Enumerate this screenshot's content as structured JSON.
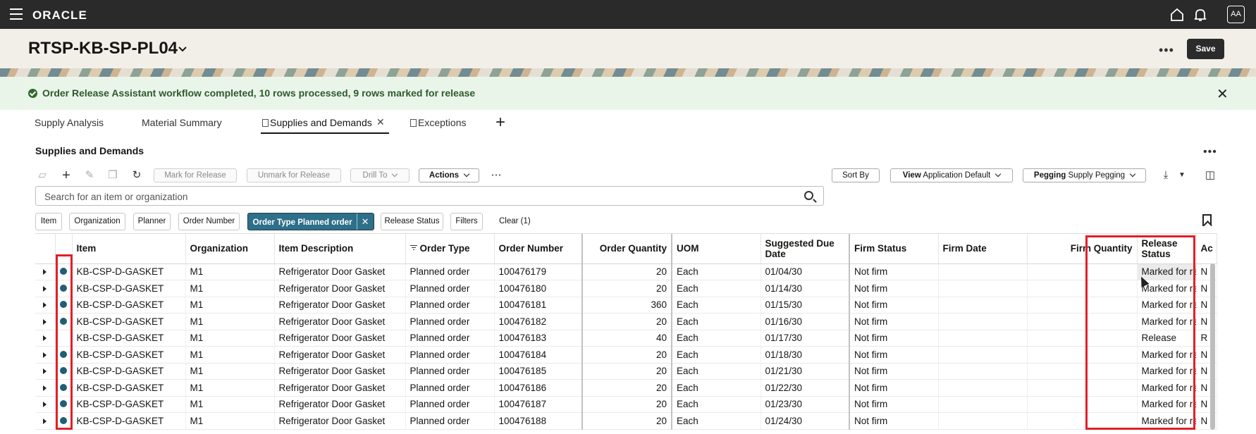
{
  "topbar": {
    "logo": "ORACLE",
    "avatar_initials": "AA"
  },
  "header": {
    "title": "RTSP-KB-SP-PL04",
    "save_label": "Save"
  },
  "banner": {
    "message": "Order Release Assistant workflow completed, 10 rows processed, 9 rows marked for release"
  },
  "tabs": [
    {
      "label": "Supply Analysis"
    },
    {
      "label": "Material Summary"
    },
    {
      "label": "Supplies and Demands"
    },
    {
      "label": "Exceptions"
    }
  ],
  "section": {
    "title": "Supplies and Demands"
  },
  "toolbar": {
    "mark_for_release": "Mark for Release",
    "unmark_for_release": "Unmark for Release",
    "drill_to": "Drill To",
    "actions": "Actions",
    "sort_by": "Sort By",
    "view_label": "View",
    "view_value": "Application Default",
    "pegging_label": "Pegging",
    "pegging_value": "Supply Pegging"
  },
  "search": {
    "placeholder": "Search for an item or organization"
  },
  "filters": {
    "chips": [
      "Item",
      "Organization",
      "Planner",
      "Order Number"
    ],
    "active_chip_label": "Order Type",
    "active_chip_value": "Planned order",
    "release_status": "Release Status",
    "filters_label": "Filters",
    "clear_label": "Clear (1)"
  },
  "table": {
    "columns": {
      "item": "Item",
      "organization": "Organization",
      "item_description": "Item Description",
      "order_type": "Order Type",
      "order_number": "Order Number",
      "order_quantity": "Order Quantity",
      "uom": "UOM",
      "suggested_due_date": "Suggested Due Date",
      "firm_status": "Firm Status",
      "firm_date": "Firm Date",
      "firm_quantity": "Firm Quantity",
      "release_status": "Release Status",
      "next_col": "Ac"
    },
    "rows": [
      {
        "item": "KB-CSP-D-GASKET",
        "org": "M1",
        "desc": "Refrigerator Door Gasket",
        "type": "Planned order",
        "number": "100476179",
        "qty": "20",
        "uom": "Each",
        "due": "01/04/30",
        "firm": "Not firm",
        "firm_date": "",
        "firm_qty": "",
        "release": "Marked for release",
        "next": "N",
        "marked": true
      },
      {
        "item": "KB-CSP-D-GASKET",
        "org": "M1",
        "desc": "Refrigerator Door Gasket",
        "type": "Planned order",
        "number": "100476180",
        "qty": "20",
        "uom": "Each",
        "due": "01/14/30",
        "firm": "Not firm",
        "firm_date": "",
        "firm_qty": "",
        "release": "Marked for release",
        "next": "N",
        "marked": true
      },
      {
        "item": "KB-CSP-D-GASKET",
        "org": "M1",
        "desc": "Refrigerator Door Gasket",
        "type": "Planned order",
        "number": "100476181",
        "qty": "360",
        "uom": "Each",
        "due": "01/15/30",
        "firm": "Not firm",
        "firm_date": "",
        "firm_qty": "",
        "release": "Marked for release",
        "next": "N",
        "marked": true
      },
      {
        "item": "KB-CSP-D-GASKET",
        "org": "M1",
        "desc": "Refrigerator Door Gasket",
        "type": "Planned order",
        "number": "100476182",
        "qty": "20",
        "uom": "Each",
        "due": "01/16/30",
        "firm": "Not firm",
        "firm_date": "",
        "firm_qty": "",
        "release": "Marked for release",
        "next": "N",
        "marked": true
      },
      {
        "item": "KB-CSP-D-GASKET",
        "org": "M1",
        "desc": "Refrigerator Door Gasket",
        "type": "Planned order",
        "number": "100476183",
        "qty": "40",
        "uom": "Each",
        "due": "01/17/30",
        "firm": "Not firm",
        "firm_date": "",
        "firm_qty": "",
        "release": "Release",
        "next": "R",
        "marked": false
      },
      {
        "item": "KB-CSP-D-GASKET",
        "org": "M1",
        "desc": "Refrigerator Door Gasket",
        "type": "Planned order",
        "number": "100476184",
        "qty": "20",
        "uom": "Each",
        "due": "01/18/30",
        "firm": "Not firm",
        "firm_date": "",
        "firm_qty": "",
        "release": "Marked for release",
        "next": "N",
        "marked": true
      },
      {
        "item": "KB-CSP-D-GASKET",
        "org": "M1",
        "desc": "Refrigerator Door Gasket",
        "type": "Planned order",
        "number": "100476185",
        "qty": "20",
        "uom": "Each",
        "due": "01/21/30",
        "firm": "Not firm",
        "firm_date": "",
        "firm_qty": "",
        "release": "Marked for release",
        "next": "N",
        "marked": true
      },
      {
        "item": "KB-CSP-D-GASKET",
        "org": "M1",
        "desc": "Refrigerator Door Gasket",
        "type": "Planned order",
        "number": "100476186",
        "qty": "20",
        "uom": "Each",
        "due": "01/22/30",
        "firm": "Not firm",
        "firm_date": "",
        "firm_qty": "",
        "release": "Marked for release",
        "next": "N",
        "marked": true
      },
      {
        "item": "KB-CSP-D-GASKET",
        "org": "M1",
        "desc": "Refrigerator Door Gasket",
        "type": "Planned order",
        "number": "100476187",
        "qty": "20",
        "uom": "Each",
        "due": "01/23/30",
        "firm": "Not firm",
        "firm_date": "",
        "firm_qty": "",
        "release": "Marked for release",
        "next": "N",
        "marked": true
      },
      {
        "item": "KB-CSP-D-GASKET",
        "org": "M1",
        "desc": "Refrigerator Door Gasket",
        "type": "Planned order",
        "number": "100476188",
        "qty": "20",
        "uom": "Each",
        "due": "01/24/30",
        "firm": "Not firm",
        "firm_date": "",
        "firm_qty": "",
        "release": "Marked for release",
        "next": "N",
        "marked": true
      }
    ]
  },
  "colors": {
    "topbar": "#2a2a2a",
    "banner_bg": "#eaf5ea",
    "active_chip": "#2e6f8a",
    "status_dot": "#1f5e75",
    "annotation": "#e0202a"
  }
}
